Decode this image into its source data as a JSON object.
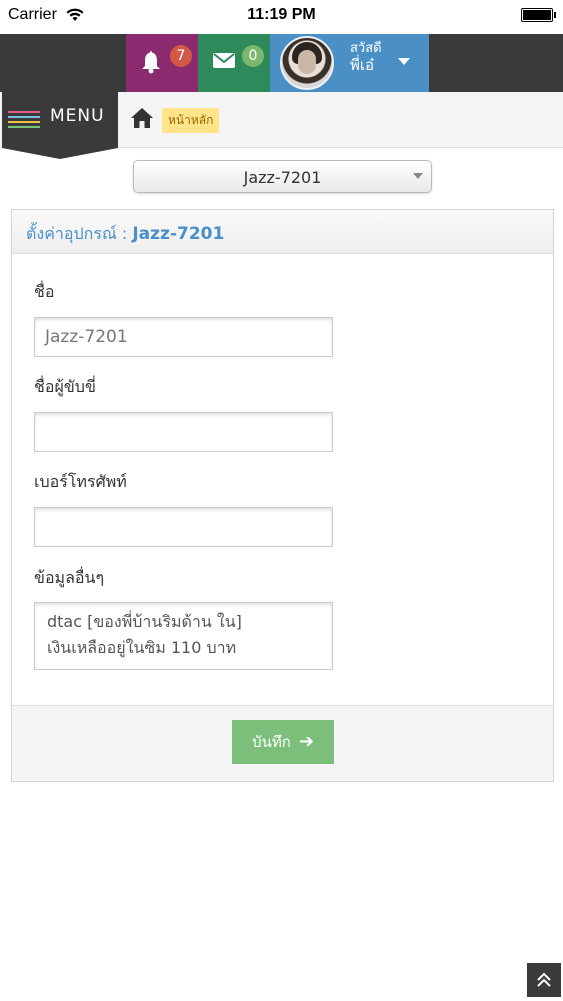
{
  "status_bar": {
    "carrier": "Carrier",
    "time": "11:19 PM"
  },
  "topnav": {
    "notifications_count": "7",
    "messages_count": "0",
    "user": {
      "greeting": "สวัสดี",
      "name": "พี่เอ๋"
    },
    "colors": {
      "notifications": "#8b2a6e",
      "messages": "#2e8a5a",
      "user": "#4a90c7"
    }
  },
  "menu": {
    "label": "MENU"
  },
  "breadcrumb": {
    "home_label": "หน้าหลัก"
  },
  "device_select": {
    "selected": "Jazz-7201"
  },
  "panel": {
    "title_prefix": "ตั้งค่าอุปกรณ์ :",
    "title_device": "Jazz-7201",
    "fields": {
      "name_label": "ชื่อ",
      "name_placeholder": "Jazz-7201",
      "driver_label": "ชื่อผู้ขับขี่",
      "driver_value": "",
      "phone_label": "เบอร์โทรศัพท์",
      "phone_value": "",
      "other_label": "ข้อมูลอื่นๆ",
      "other_line1": "dtac [ของพี่บ้านริมด้าน ใน]",
      "other_line2": "เงินเหลืออยู่ในซิม 110 บาท"
    },
    "save_label": "บันทึก"
  },
  "icons": {
    "bell": "bell-icon",
    "envelope": "envelope-icon",
    "home": "home-icon",
    "arrow": "arrow-right-icon",
    "scroll": "double-chevron-up-icon"
  }
}
